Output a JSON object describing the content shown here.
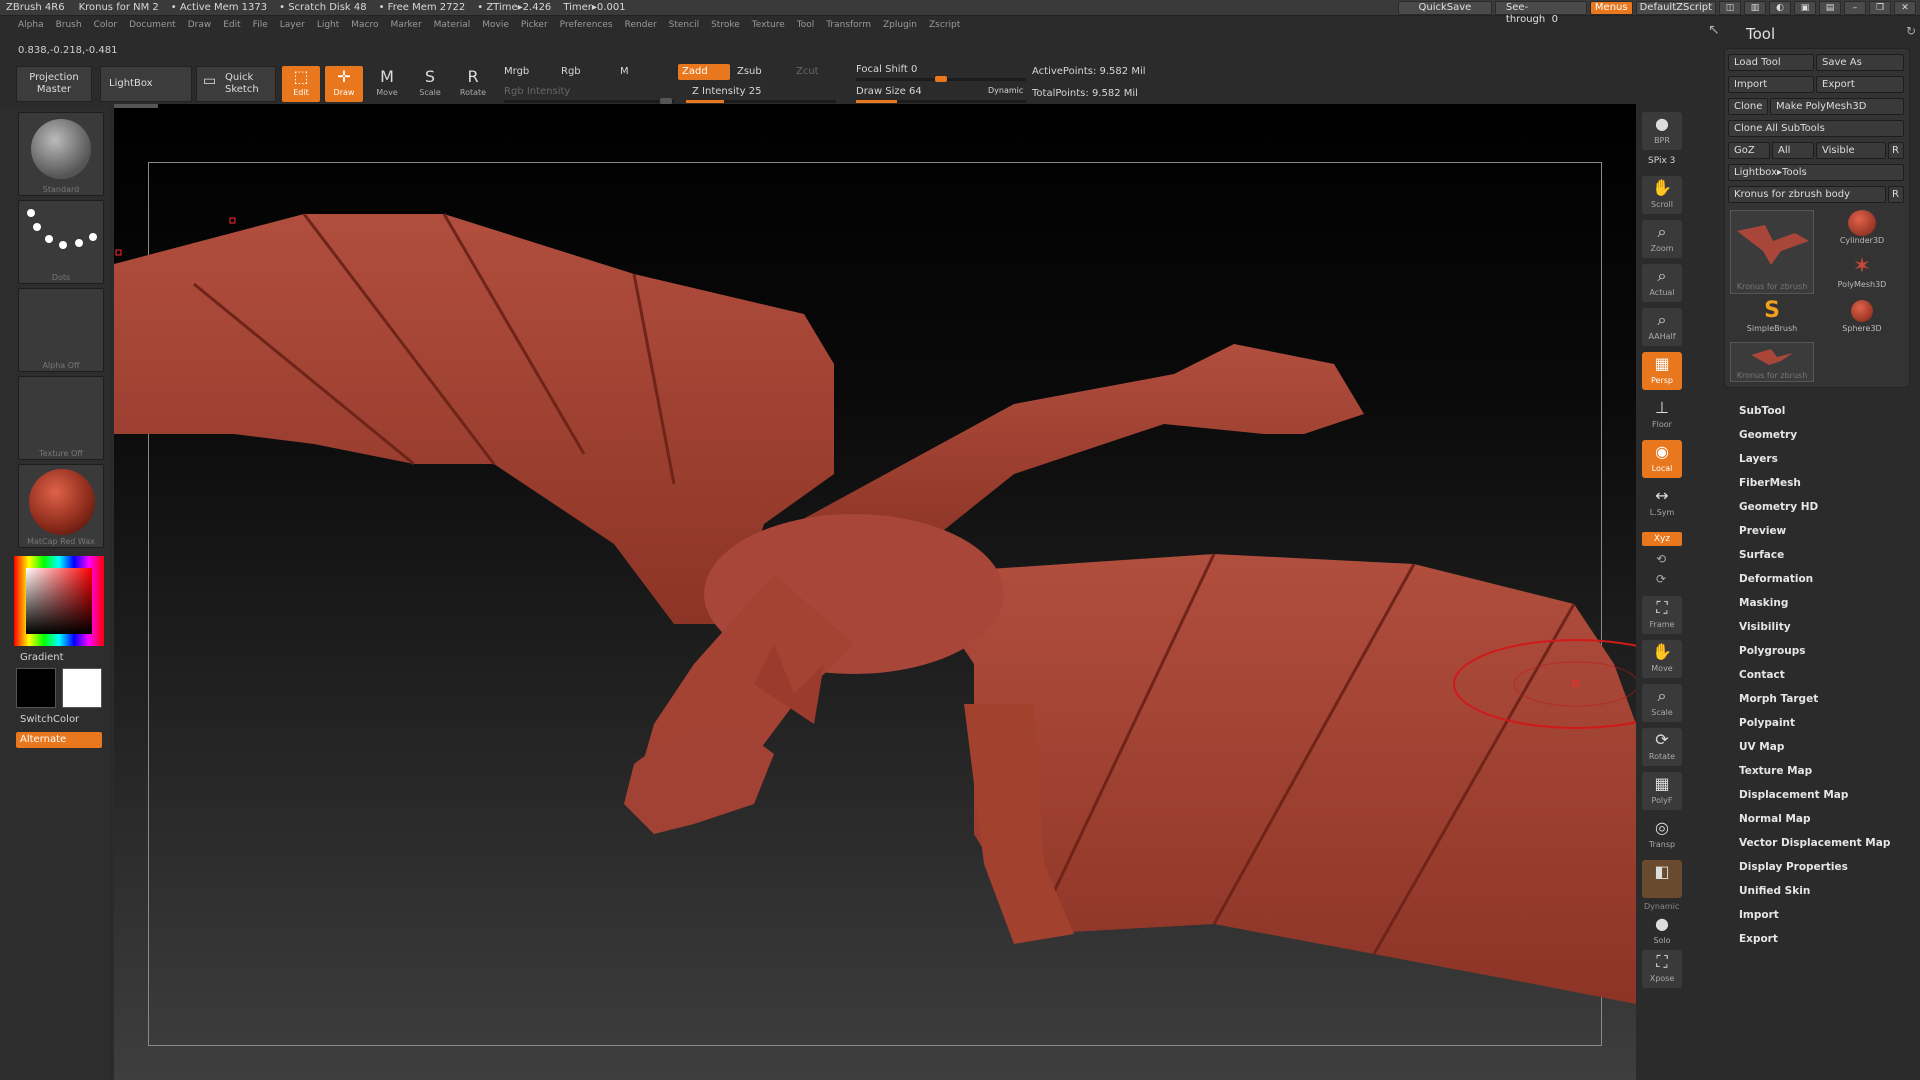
{
  "titlebar": {
    "app": "ZBrush 4R6",
    "doc": "Kronus for NM 2",
    "active_mem": "• Active Mem 1373",
    "scratch": "• Scratch Disk 48",
    "free_mem": "• Free Mem 2722",
    "ztime": "• ZTime▸2.426",
    "timer": "Timer▸0.001",
    "quicksave": "QuickSave",
    "seethrough": "See-through",
    "seethrough_val": "0",
    "menus": "Menus",
    "zscript": "DefaultZScript"
  },
  "menus": [
    "Alpha",
    "Brush",
    "Color",
    "Document",
    "Draw",
    "Edit",
    "File",
    "Layer",
    "Light",
    "Macro",
    "Marker",
    "Material",
    "Movie",
    "Picker",
    "Preferences",
    "Render",
    "Stencil",
    "Stroke",
    "Texture",
    "Tool",
    "Transform",
    "Zplugin",
    "Zscript"
  ],
  "coords": "0.838,-0.218,-0.481",
  "shelf": {
    "projection_master": "Projection Master",
    "lightbox": "LightBox",
    "quick_sketch": "Quick Sketch",
    "edit": "Edit",
    "draw": "Draw",
    "move": "Move",
    "scale": "Scale",
    "rotate": "Rotate",
    "mrgb": "Mrgb",
    "rgb": "Rgb",
    "m": "M",
    "rgb_intensity": "Rgb Intensity",
    "zadd": "Zadd",
    "zsub": "Zsub",
    "zcut": "Zcut",
    "z_intensity": "Z Intensity 25",
    "focal_shift": "Focal Shift 0",
    "draw_size": "Draw Size 64",
    "dynamic": "Dynamic",
    "active_points": "ActivePoints: 9.582 Mil",
    "total_points": "TotalPoints: 9.582 Mil",
    "z_intensity_val": 25,
    "focal_shift_val": 0,
    "draw_size_val": 64
  },
  "left": {
    "standard": "Standard",
    "dots": "Dots",
    "alpha_off": "Alpha Off",
    "texture_off": "Texture Off",
    "matcap": "MatCap Red Wax",
    "gradient": "Gradient",
    "switchcolor": "SwitchColor",
    "alternate": "Alternate"
  },
  "rightstrip": {
    "bpr": "BPR",
    "spix": "SPix 3",
    "scroll": "Scroll",
    "zoom": "Zoom",
    "actual": "Actual",
    "aahalf": "AAHalf",
    "persp": "Persp",
    "floor": "Floor",
    "local": "Local",
    "lsym": "L.Sym",
    "xyz": "Xyz",
    "frame": "Frame",
    "move": "Move",
    "scale": "Scale",
    "rotate": "Rotate",
    "polyf": "PolyF",
    "transp": "Transp",
    "dynamic": "Dynamic",
    "solo": "Solo",
    "xpose": "Xpose"
  },
  "tool": {
    "title": "Tool",
    "load_tool": "Load Tool",
    "save_as": "Save As",
    "import": "Import",
    "export": "Export",
    "clone": "Clone",
    "make_polymesh": "Make PolyMesh3D",
    "clone_all": "Clone All SubTools",
    "goz": "GoZ",
    "all": "All",
    "visible": "Visible",
    "r": "R",
    "lightbox_tools": "Lightbox▸Tools",
    "current": "Kronus for zbrush body",
    "thumbs": [
      "Kronus for zbrush",
      "Cylinder3D",
      "PolyMesh3D",
      "SimpleBrush",
      "Sphere3D",
      "Kronus for zbrush"
    ],
    "sections": [
      "SubTool",
      "Geometry",
      "Layers",
      "FiberMesh",
      "Geometry HD",
      "Preview",
      "Surface",
      "Deformation",
      "Masking",
      "Visibility",
      "Polygroups",
      "Contact",
      "Morph Target",
      "Polypaint",
      "UV Map",
      "Texture Map",
      "Displacement Map",
      "Normal Map",
      "Vector Displacement Map",
      "Display Properties",
      "Unified Skin",
      "Import",
      "Export"
    ]
  }
}
